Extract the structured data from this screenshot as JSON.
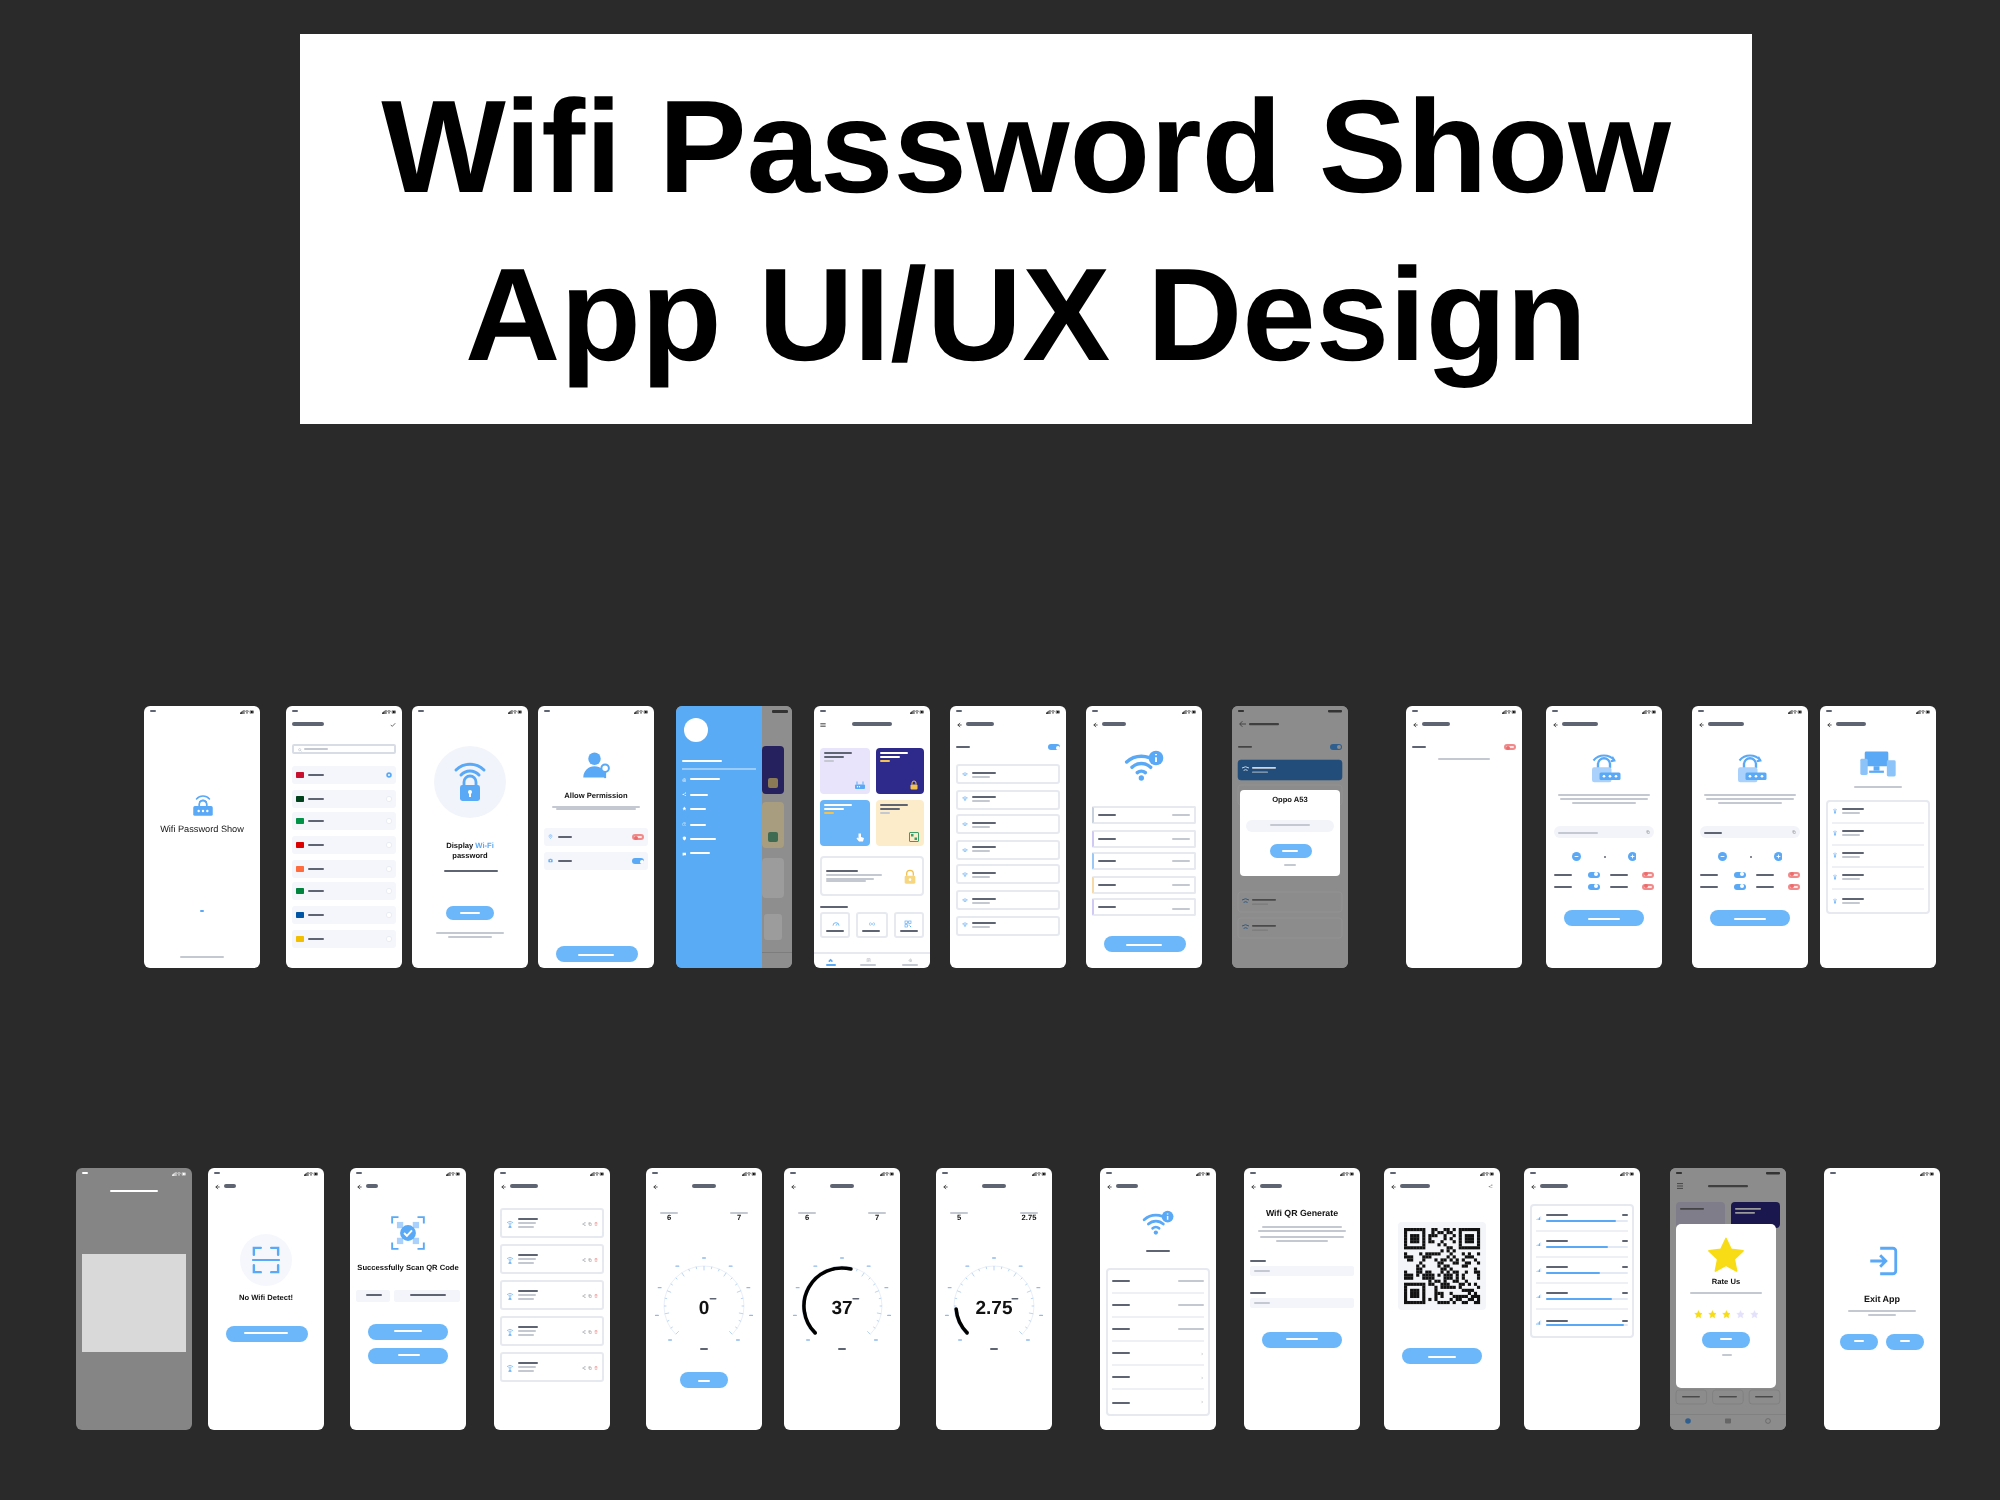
{
  "title": {
    "lines": [
      "Wifi Password Show",
      "App UI/UX Design"
    ]
  },
  "rows": [
    {
      "screens": [
        {
          "kind": "splash",
          "app_name": "Wifi Password Show"
        },
        {
          "kind": "language",
          "languages": [
            {
              "color": "#c8102e",
              "selected": true
            },
            {
              "color": "#01411c",
              "selected": false
            },
            {
              "color": "#009246",
              "selected": false
            },
            {
              "color": "#dd0000",
              "selected": false
            },
            {
              "color": "#ff6b3d",
              "selected": false
            },
            {
              "color": "#00843d",
              "selected": false
            },
            {
              "color": "#0055a4",
              "selected": false
            },
            {
              "color": "#f1bf00",
              "selected": false
            }
          ]
        },
        {
          "kind": "onboarding",
          "heading": {
            "start": "Display",
            "highlight": "Wi-Fi",
            "end": "password"
          }
        },
        {
          "kind": "permission",
          "title": "Allow Permission",
          "permissions": [
            {
              "on": false
            },
            {
              "on": true
            }
          ]
        },
        {
          "kind": "drawer"
        },
        {
          "kind": "home",
          "cards": [
            {
              "color": "#e7e4fb"
            },
            {
              "color": "#2e2a8c"
            },
            {
              "color": "#6ab4f8"
            },
            {
              "color": "#fdecc9"
            }
          ],
          "nav": [
            {
              "selected": true
            },
            {
              "selected": false
            },
            {
              "selected": false
            }
          ]
        },
        {
          "kind": "nearby",
          "wifi_on": true
        },
        {
          "kind": "details"
        },
        {
          "kind": "password_dialog",
          "dialog_title": "Oppo A53"
        },
        {
          "kind": "nearby",
          "wifi_on": false
        },
        {
          "kind": "generator",
          "field_filled": false,
          "options": [
            {
              "on": true
            },
            {
              "on": false
            },
            {
              "on": true
            },
            {
              "on": false
            }
          ]
        },
        {
          "kind": "generator",
          "field_filled": true,
          "options": [
            {
              "on": true
            },
            {
              "on": false
            },
            {
              "on": true
            },
            {
              "on": false
            }
          ]
        },
        {
          "kind": "devices"
        }
      ]
    },
    {
      "screens": [
        {
          "kind": "camera"
        },
        {
          "kind": "scan_failed",
          "message": "No Wifi Detect!"
        },
        {
          "kind": "scan_success",
          "message": "Successfully Scan QR Code"
        },
        {
          "kind": "saved"
        },
        {
          "kind": "speed",
          "download": "6",
          "upload": "7",
          "gauge": {
            "reading": "0"
          },
          "start_button": true
        },
        {
          "kind": "speed",
          "download": "6",
          "upload": "7",
          "gauge": {
            "level": 0.55,
            "reading": "37"
          }
        },
        {
          "kind": "speed",
          "download": "5",
          "upload": "2.75",
          "gauge": {
            "level": 0.15,
            "reading": "2.75"
          }
        },
        {
          "kind": "wifi_info",
          "rows": [
            {
              "kind": "value"
            },
            {
              "kind": "value"
            },
            {
              "kind": "value"
            },
            {
              "kind": "link"
            },
            {
              "kind": "link"
            },
            {
              "kind": "link"
            }
          ]
        },
        {
          "kind": "qr_form",
          "heading": "Wifi QR Generate"
        },
        {
          "kind": "qr_result"
        },
        {
          "kind": "signal",
          "networks": [
            {
              "level": 0.85
            },
            {
              "level": 0.75
            },
            {
              "level": 0.65
            },
            {
              "level": 0.8
            },
            {
              "level": 0.95
            }
          ]
        },
        {
          "kind": "rate",
          "dialog": {
            "title": "Rate Us",
            "stars": 3
          }
        },
        {
          "kind": "exit",
          "title": "Exit App"
        }
      ]
    }
  ]
}
